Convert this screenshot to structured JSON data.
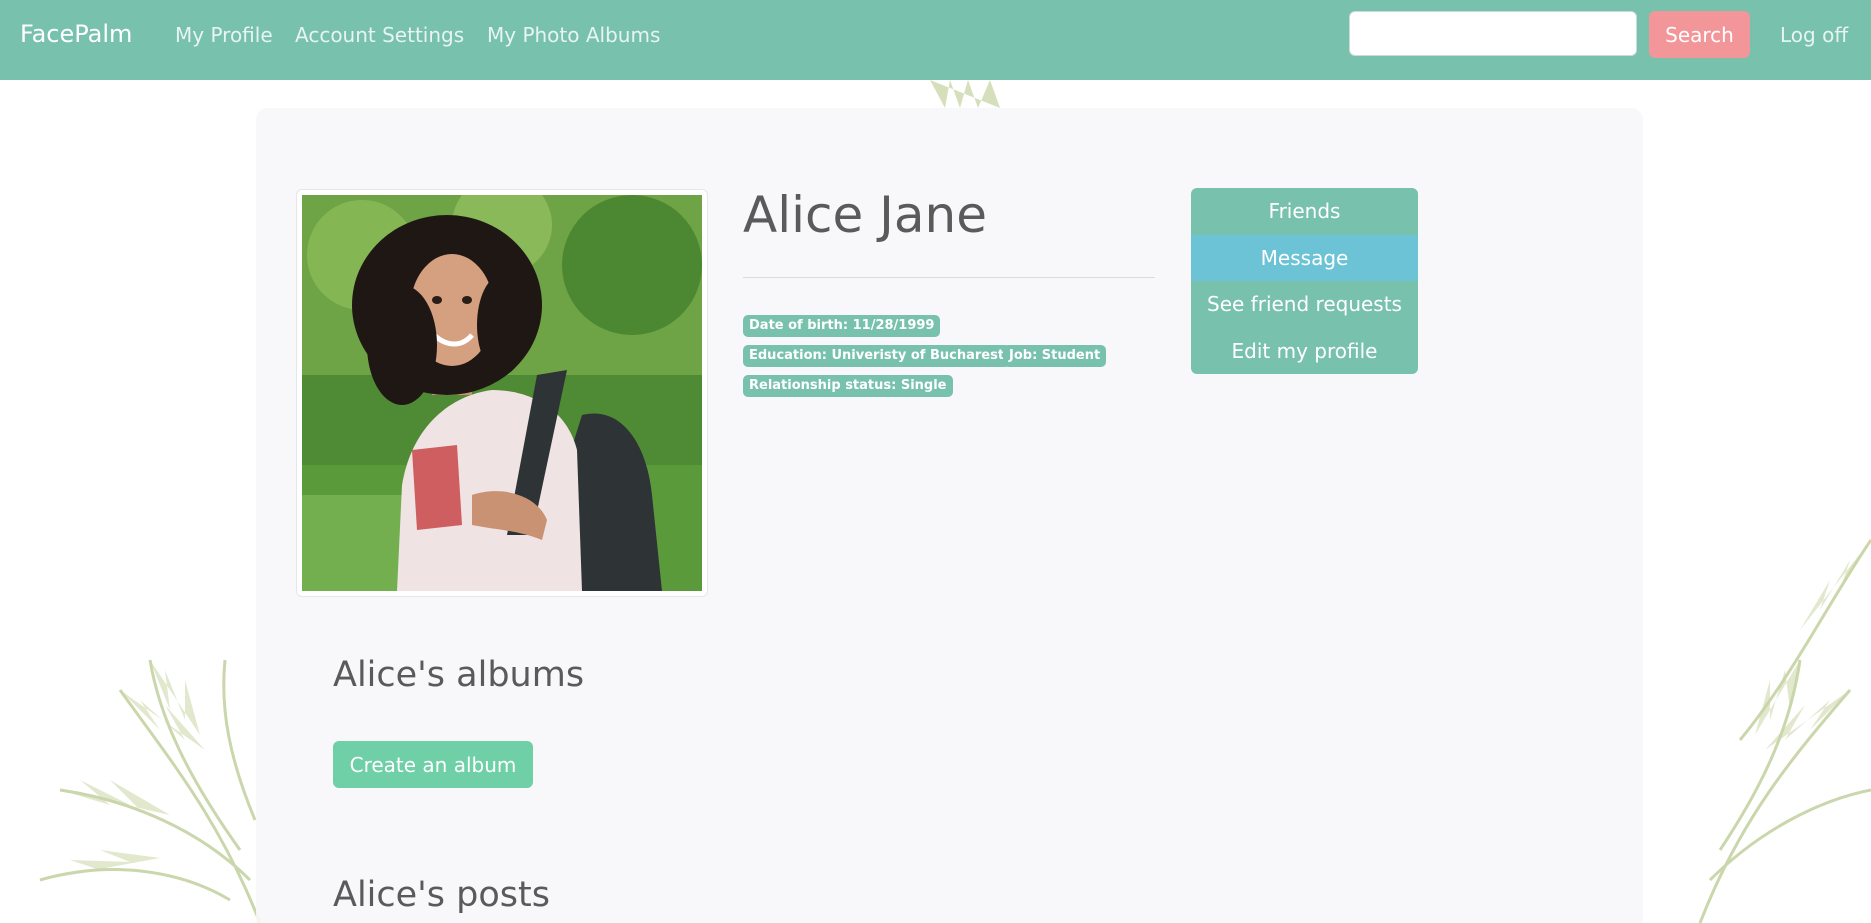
{
  "navbar": {
    "brand": "FacePalm",
    "links": [
      "My Profile",
      "Account Settings",
      "My Photo Albums"
    ],
    "search": {
      "value": "",
      "placeholder": ""
    },
    "search_button": "Search",
    "logoff": "Log off"
  },
  "profile": {
    "name": "Alice Jane",
    "badges": {
      "dob": "Date of birth: 11/28/1999",
      "education": "Education: Univeristy of Bucharest",
      "job": "Job: Student",
      "relationship": "Relationship status: Single"
    },
    "actions": [
      "Friends",
      "Message",
      "See friend requests",
      "Edit my profile"
    ],
    "active_action": "Message"
  },
  "albums": {
    "title": "Alice's albums",
    "create_button": "Create an album"
  },
  "posts": {
    "title": "Alice's posts"
  },
  "colors": {
    "primary": "#78c2ad",
    "info": "#6cc3d5",
    "secondary": "#f3969a",
    "success": "#6fcfa6"
  }
}
